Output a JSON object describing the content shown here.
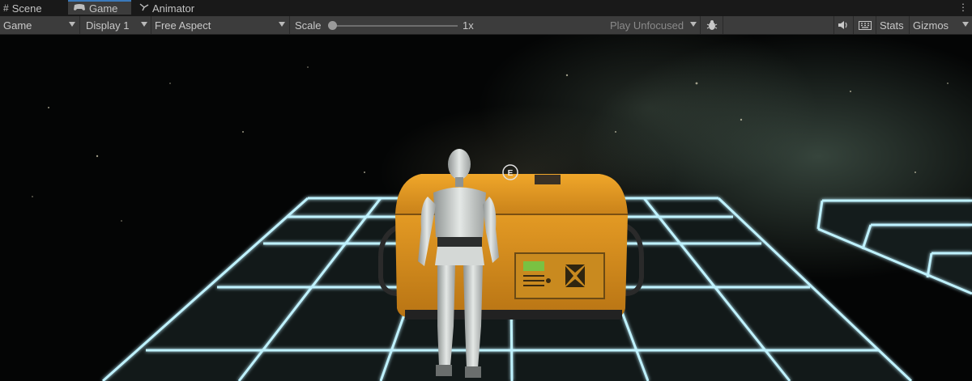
{
  "tabs": [
    {
      "label": "Scene",
      "icon": "grid-icon"
    },
    {
      "label": "Game",
      "icon": "gamepad-icon"
    },
    {
      "label": "Animator",
      "icon": "animator-icon"
    }
  ],
  "toolbar": {
    "mode": "Game",
    "display": "Display 1",
    "aspect": "Free Aspect",
    "scale_label": "Scale",
    "scale_value": "1x",
    "scale_level": 0,
    "play_mode": "Play Unfocused",
    "stats": "Stats",
    "gizmos": "Gizmos"
  },
  "scene": {
    "interact_prompt": "E"
  },
  "colors": {
    "grid_line": "#bff2ff",
    "chest": "#e69b22",
    "tab_active": "#3c3c3c",
    "toolbar": "#3c3c3c"
  }
}
